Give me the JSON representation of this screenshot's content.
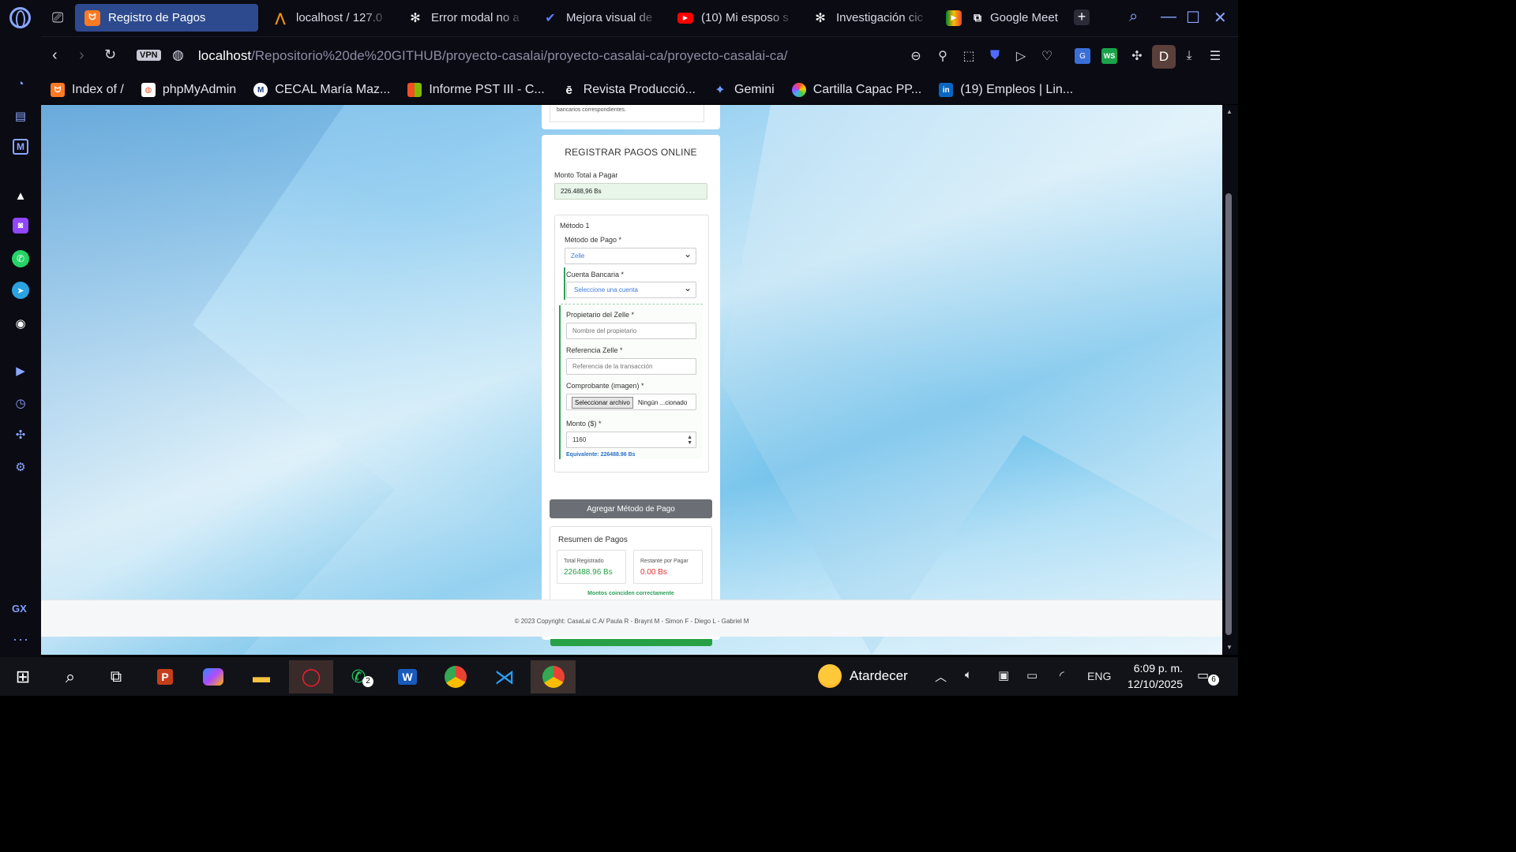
{
  "browser": {
    "tabs": [
      {
        "label": "Registro de Pagos",
        "icon": "xampp-icon",
        "active": true
      },
      {
        "label": "localhost / 127.0",
        "icon": "phpmyadmin-icon"
      },
      {
        "label": "Error modal no a",
        "icon": "chatgpt-icon"
      },
      {
        "label": "Mejora visual de",
        "icon": "bird-icon"
      },
      {
        "label": "(10) Mi esposo s",
        "icon": "youtube-icon"
      },
      {
        "label": "Investigación cic",
        "icon": "chatgpt-icon"
      },
      {
        "label": "Google Meet",
        "icon": "meet-icon"
      }
    ],
    "vpn_label": "VPN",
    "url_host": "localhost",
    "url_path": "/Repositorio%20de%20GITHUB/proyecto-casalai/proyecto-casalai-ca/proyecto-casalai-ca/",
    "avatar_letter": "D",
    "bookmarks": [
      {
        "label": "Index of /",
        "icon": "xampp-icon"
      },
      {
        "label": "phpMyAdmin",
        "icon": "phpmyadmin-icon"
      },
      {
        "label": "CECAL María Maz...",
        "icon": "cecal-icon"
      },
      {
        "label": "Informe PST III - C...",
        "icon": "microsoft-icon"
      },
      {
        "label": "Revista Producció...",
        "icon": "e-icon"
      },
      {
        "label": "Gemini",
        "icon": "gemini-icon"
      },
      {
        "label": "Cartilla Capac PP...",
        "icon": "color-wheel-icon"
      },
      {
        "label": "(19) Empleos | Lin...",
        "icon": "linkedin-icon"
      }
    ]
  },
  "page": {
    "top_snippet": "bancarios correspondientes.",
    "title": "REGISTRAR PAGOS ONLINE",
    "total_label": "Monto Total a Pagar",
    "total_value": "226.488,96 Bs",
    "method_heading": "Método 1",
    "payment_method_label": "Método de Pago *",
    "payment_method_value": "Zelle",
    "bank_account_label": "Cuenta Bancaria *",
    "bank_account_value": "Seleccione una cuenta",
    "zelle_owner_label": "Propietario del Zelle *",
    "zelle_owner_placeholder": "Nombre del propietario",
    "zelle_ref_label": "Referencia Zelle *",
    "zelle_ref_placeholder": "Referencia de la transacción",
    "receipt_label": "Comprobante (imagen) *",
    "file_button": "Seleccionar archivo",
    "file_status": "Ningún ...cionado",
    "amount_label": "Monto ($) *",
    "amount_value": "1160",
    "equivalent": "Equivalente: 226488.96 Bs",
    "add_method_button": "Agregar Método de Pago",
    "summary_title": "Resumen de Pagos",
    "total_registered_label": "Total Registrado",
    "total_registered_value": "226488.96 Bs",
    "remaining_label": "Restante por Pagar",
    "remaining_value": "0.00 Bs",
    "match_message": "Montos coinciden correctamente",
    "footer": "© 2023 Copyright: CasaLai C.A/ Paula R - Braynt M - Simon F - Diego L - Gabriel M"
  },
  "taskbar": {
    "weather": "Atardecer",
    "language": "ENG",
    "time": "6:09 p. m.",
    "date": "12/10/2025",
    "whatsapp_badge": "2",
    "notifications_badge": "6"
  },
  "colors": {
    "active_tab": "#2d4a8e",
    "success_green": "#2e9e5a",
    "remaining_red": "#e03131",
    "registered_green": "#27a046",
    "link_blue": "#2a6fc9"
  }
}
